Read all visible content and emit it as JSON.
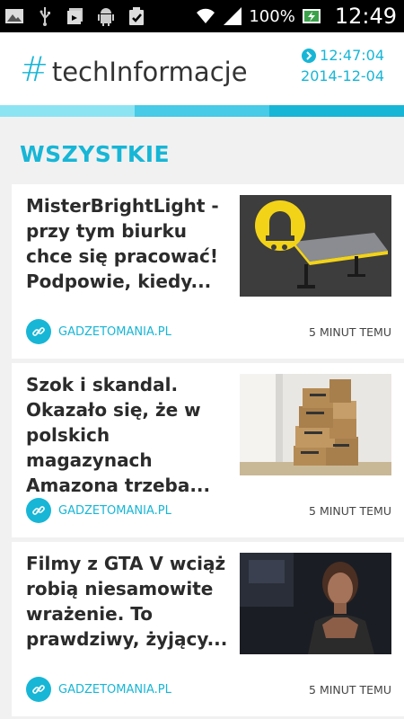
{
  "status_bar": {
    "battery_text": "100%",
    "time": "12:49",
    "icons": [
      "image-icon",
      "usb-icon",
      "media-upload-icon",
      "android-icon",
      "clipboard-check-icon",
      "wifi-icon",
      "signal-icon",
      "battery-charging-icon"
    ]
  },
  "header": {
    "hash": "#",
    "title": "techInformacje",
    "clock_time": "12:47:04",
    "clock_date": "2014-12-04"
  },
  "colors": {
    "accent": "#17b6d6",
    "tab_light": "#8ce4f3",
    "tab_mid": "#47cbe6",
    "tab_dark": "#17b6d6"
  },
  "section": {
    "title": "WSZYSTKIE"
  },
  "articles": [
    {
      "title": "MisterBrightLight - przy tym biurku chce się pracować! Podpowie, kiedy...",
      "source": "GADZETOMANIA.PL",
      "time_ago": "5 MINUT TEMU",
      "thumbnail": "desk-image"
    },
    {
      "title": "Szok i skandal. Okazało się, że w polskich magazynach Amazona trzeba...",
      "source": "GADZETOMANIA.PL",
      "time_ago": "5 MINUT TEMU",
      "thumbnail": "amazon-boxes-image"
    },
    {
      "title": "Filmy z GTA V wciąż robią niesamowite wrażenie. To prawdziwy, żyjący...",
      "source": "GADZETOMANIA.PL",
      "time_ago": "5 MINUT TEMU",
      "thumbnail": "gta-woman-image"
    }
  ]
}
